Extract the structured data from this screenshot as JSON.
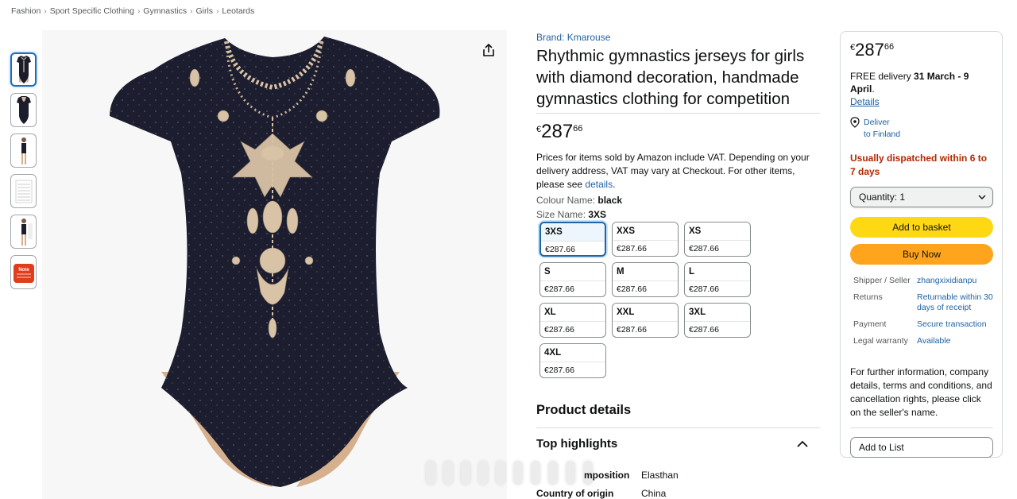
{
  "breadcrumb": [
    "Fashion",
    "Sport Specific Clothing",
    "Gymnastics",
    "Girls",
    "Leotards"
  ],
  "thumbnails": [
    "leotard-front",
    "leotard-back",
    "model-full",
    "size-chart",
    "model-side",
    "note-badge"
  ],
  "thumb_note_text": "Note",
  "product": {
    "brand": "Brand: Kmarouse",
    "title": "Rhythmic gymnastics jerseys for girls with diamond decoration, handmade gymnastics clothing for competition",
    "price_symbol": "€",
    "price_whole": "287",
    "price_fraction": "66",
    "vat_text": "Prices for items sold by Amazon include VAT. Depending on your delivery address, VAT may vary at Checkout. For other items, please see ",
    "vat_link": "details",
    "vat_end": ".",
    "colour_label": "Colour Name: ",
    "colour_value": "black",
    "size_label": "Size Name: ",
    "size_value": "3XS"
  },
  "sizes": [
    {
      "name": "3XS",
      "price": "€287.66",
      "selected": true
    },
    {
      "name": "XXS",
      "price": "€287.66"
    },
    {
      "name": "XS",
      "price": "€287.66"
    },
    {
      "name": "S",
      "price": "€287.66"
    },
    {
      "name": "M",
      "price": "€287.66"
    },
    {
      "name": "L",
      "price": "€287.66"
    },
    {
      "name": "XL",
      "price": "€287.66"
    },
    {
      "name": "XXL",
      "price": "€287.66"
    },
    {
      "name": "3XL",
      "price": "€287.66"
    },
    {
      "name": "4XL",
      "price": "€287.66"
    }
  ],
  "details": {
    "heading": "Product details",
    "highlights_heading": "Top highlights",
    "specs": [
      {
        "key": "mposition",
        "value": "Elasthan"
      },
      {
        "key": "Country of origin",
        "value": "China"
      }
    ]
  },
  "buybox": {
    "price_symbol": "€",
    "price_whole": "287",
    "price_fraction": "66",
    "delivery_pre": "FREE delivery ",
    "delivery_dates": "31 March - 9 April",
    "delivery_post": ".",
    "details_link": "Details",
    "deliver_line1": "Deliver",
    "deliver_line2": "to Finland",
    "dispatch": "Usually dispatched within 6 to 7 days",
    "quantity": "Quantity:  1",
    "add_to_basket": "Add to basket",
    "buy_now": "Buy Now",
    "info": [
      {
        "k": "Shipper / Seller",
        "v": "zhangxixidianpu"
      },
      {
        "k": "Returns",
        "v": "Returnable within 30 days of receipt"
      },
      {
        "k": "Payment",
        "v": "Secure transaction"
      },
      {
        "k": "Legal warranty",
        "v": "Available"
      }
    ],
    "further_info": "For further information, company details, terms and conditions, and cancellation rights, please click on the seller's name.",
    "add_to_list": "Add to List"
  },
  "colors": {
    "link": "#2162a1",
    "basket": "#ffd814",
    "buy_now": "#ffa41c",
    "dispatch": "#b12704",
    "selected": "#2162a1"
  }
}
